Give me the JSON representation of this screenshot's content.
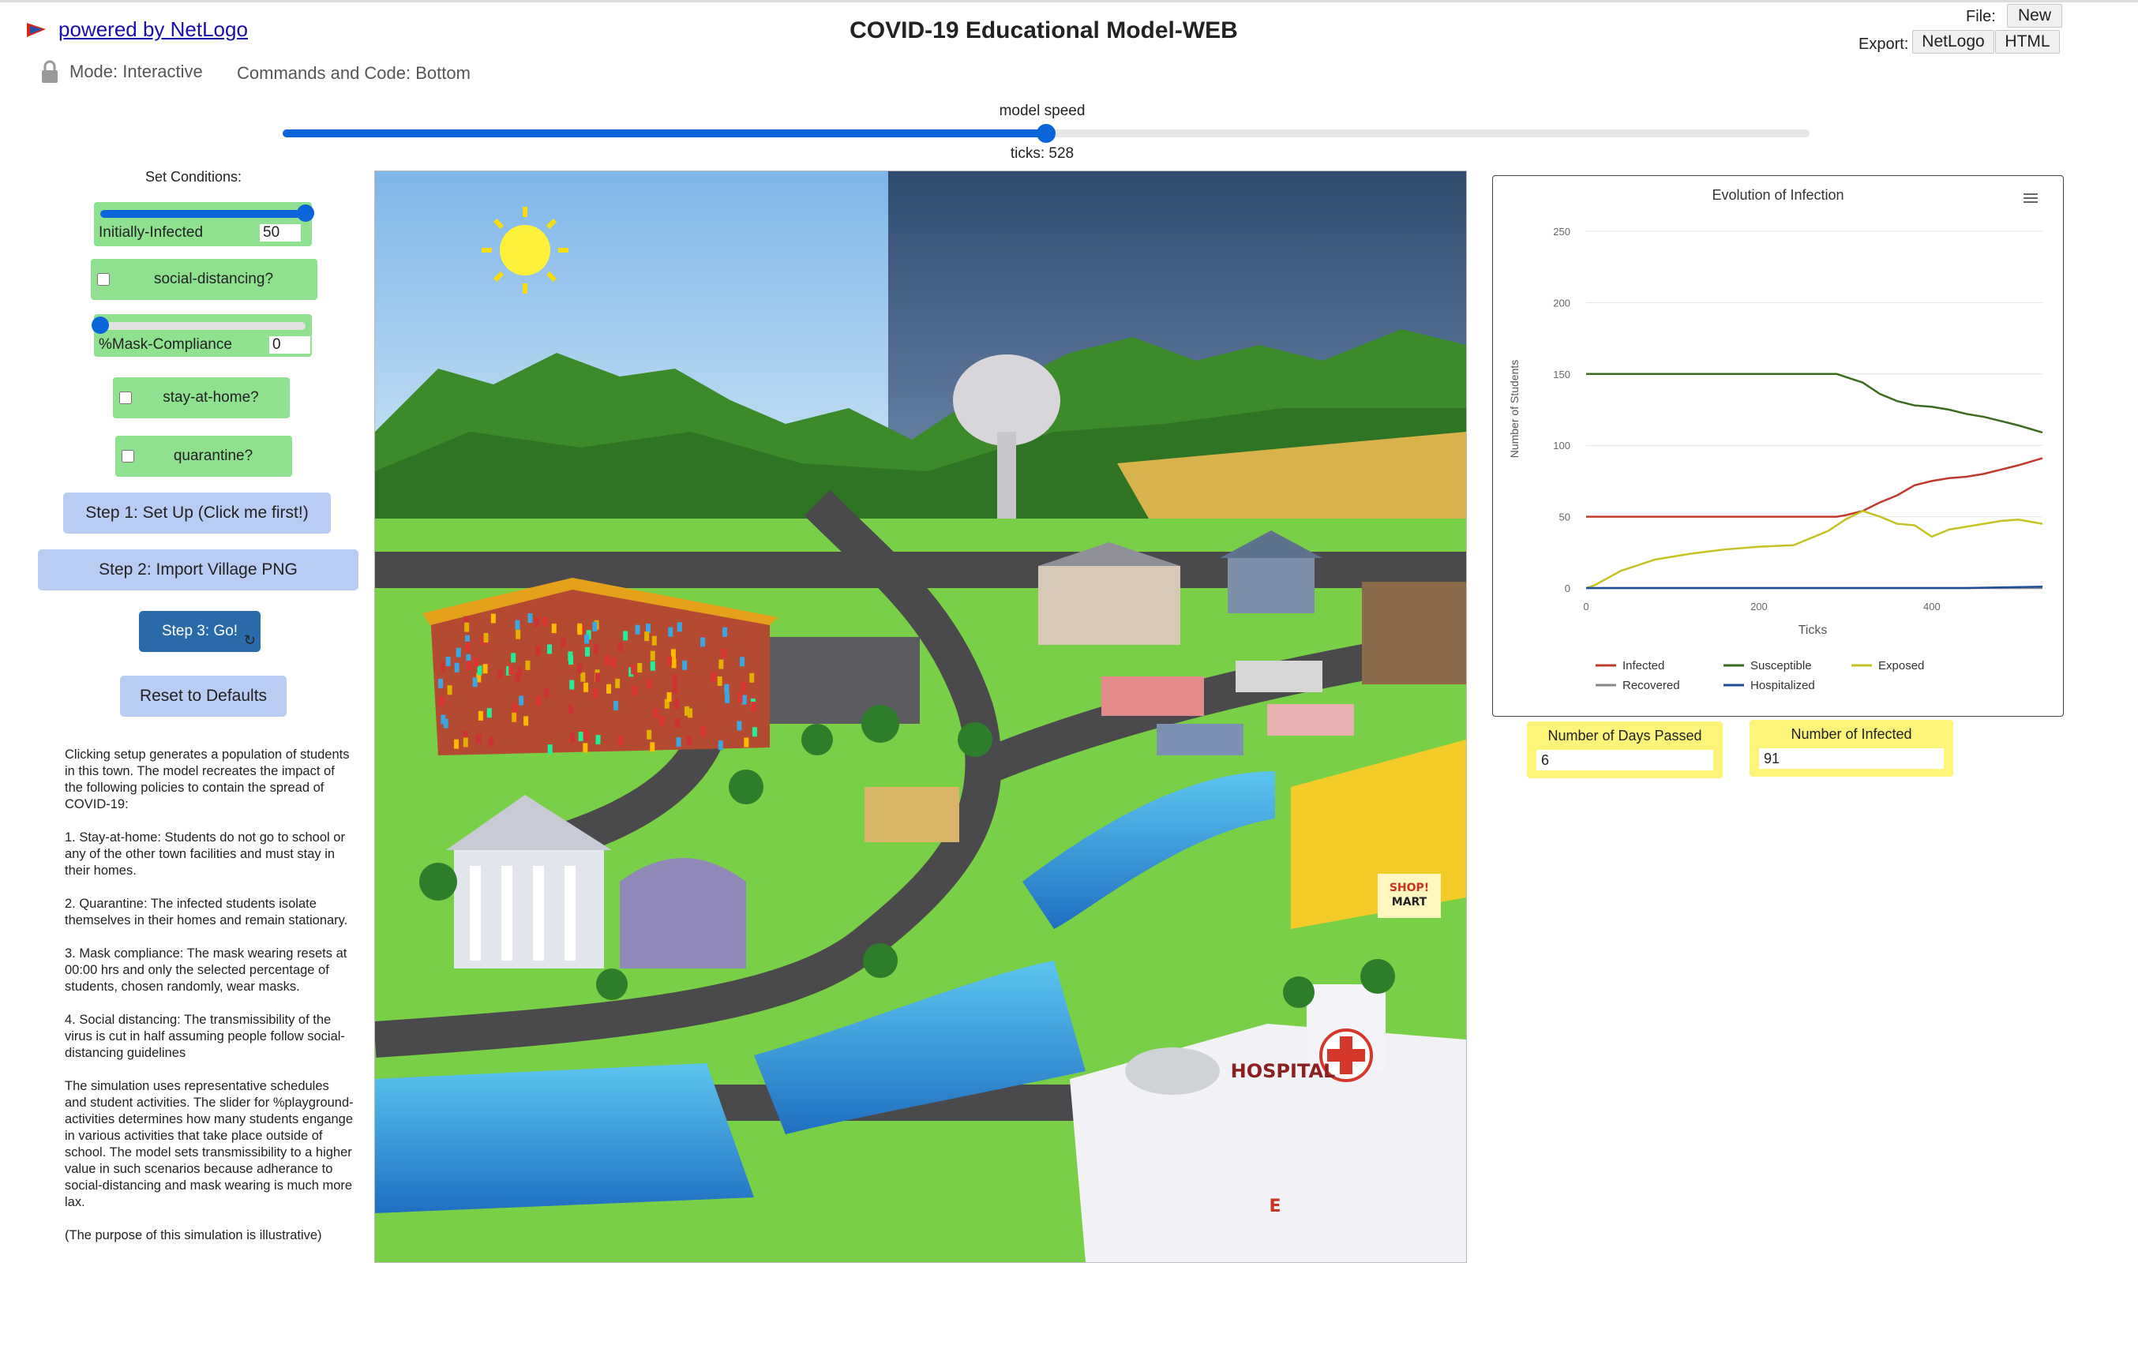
{
  "header": {
    "powered_by": "powered by NetLogo",
    "title": "COVID-19 Educational Model-WEB",
    "file_label": "File:",
    "new_button": "New",
    "export_label": "Export:",
    "export_netlogo": "NetLogo",
    "export_html": "HTML",
    "mode": "Mode: Interactive",
    "commands": "Commands and Code: Bottom"
  },
  "speed": {
    "label": "model speed",
    "value": 0.5,
    "ticks": "ticks: 528"
  },
  "controls": {
    "heading": "Set Conditions:",
    "initially_infected": {
      "label": "Initially-Infected",
      "value": "50",
      "fraction": 1.0
    },
    "social_distancing": {
      "label": "social-distancing?",
      "checked": false
    },
    "mask_compliance": {
      "label": "%Mask-Compliance",
      "value": "0",
      "fraction": 0.0
    },
    "stay_at_home": {
      "label": "stay-at-home?",
      "checked": false
    },
    "quarantine": {
      "label": "quarantine?",
      "checked": false
    },
    "setup_button": "Step 1: Set Up (Click me first!)",
    "import_button": "Step 2: Import Village PNG",
    "go_button": "Step 3: Go!",
    "reset_button": "Reset to Defaults"
  },
  "info": [
    "Clicking setup generates a population of students in this town. The model recreates the impact of the following policies to contain the spread of COVID-19:",
    "1. Stay-at-home: Students do not go to school or any of the other town facilities and must stay in their homes.",
    "2. Quarantine: The infected students isolate themselves in their homes and remain stationary.",
    "3. Mask compliance: The mask wearing resets at 00:00 hrs and only the selected percentage of students, chosen randomly, wear masks.",
    "4. Social distancing: The transmissibility of the virus is cut in half assuming people follow social-distancing guidelines",
    "The simulation uses representative schedules and student activities. The slider for %playground-activities determines how many students engange in various activities that take place outside of school. The model sets transmissibility to a higher value in such scenarios because adherance to social-distancing and mask wearing is much more lax.",
    "(The purpose of this simulation is illustrative)"
  ],
  "view": {
    "signs": {
      "shop_line1": "SHOP!",
      "shop_line2": "MART",
      "hospital": "HOSPITAL",
      "emergency": "E"
    }
  },
  "monitors": {
    "days_label": "Number of Days Passed",
    "days_value": "6",
    "infected_label": "Number of Infected",
    "infected_value": "91"
  },
  "chart_data": {
    "type": "line",
    "title": "Evolution of Infection",
    "xlabel": "Ticks",
    "ylabel": "Number of Students",
    "xlim": [
      0,
      528
    ],
    "ylim": [
      0,
      250
    ],
    "xticks": [
      "0",
      "200",
      "400"
    ],
    "yticks": [
      "0",
      "50",
      "100",
      "150",
      "200",
      "250"
    ],
    "grid": true,
    "legend_position": "bottom",
    "colors": {
      "Infected": "#c0392b",
      "Susceptible": "#3a6b1f",
      "Exposed": "#c5c223",
      "Recovered": "#888888",
      "Hospitalized": "#1f4e9c"
    },
    "series": [
      {
        "name": "Infected",
        "x": [
          0,
          290,
          300,
          320,
          340,
          360,
          380,
          400,
          420,
          440,
          460,
          480,
          500,
          528
        ],
        "y": [
          50,
          50,
          51,
          54,
          60,
          65,
          72,
          75,
          77,
          78,
          80,
          83,
          86,
          91
        ]
      },
      {
        "name": "Susceptible",
        "x": [
          0,
          290,
          300,
          320,
          340,
          360,
          380,
          400,
          420,
          440,
          460,
          480,
          500,
          528
        ],
        "y": [
          150,
          150,
          148,
          144,
          136,
          131,
          128,
          127,
          125,
          122,
          120,
          117,
          114,
          109
        ]
      },
      {
        "name": "Exposed",
        "x": [
          0,
          10,
          40,
          80,
          120,
          160,
          200,
          240,
          280,
          300,
          320,
          340,
          360,
          380,
          400,
          420,
          440,
          460,
          480,
          500,
          528
        ],
        "y": [
          0,
          2,
          12,
          20,
          24,
          27,
          29,
          30,
          40,
          48,
          54,
          50,
          45,
          44,
          36,
          41,
          43,
          45,
          47,
          48,
          45
        ]
      },
      {
        "name": "Recovered",
        "x": [
          0,
          528
        ],
        "y": [
          0,
          0
        ]
      },
      {
        "name": "Hospitalized",
        "x": [
          0,
          440,
          528
        ],
        "y": [
          0,
          0,
          1
        ]
      }
    ]
  }
}
